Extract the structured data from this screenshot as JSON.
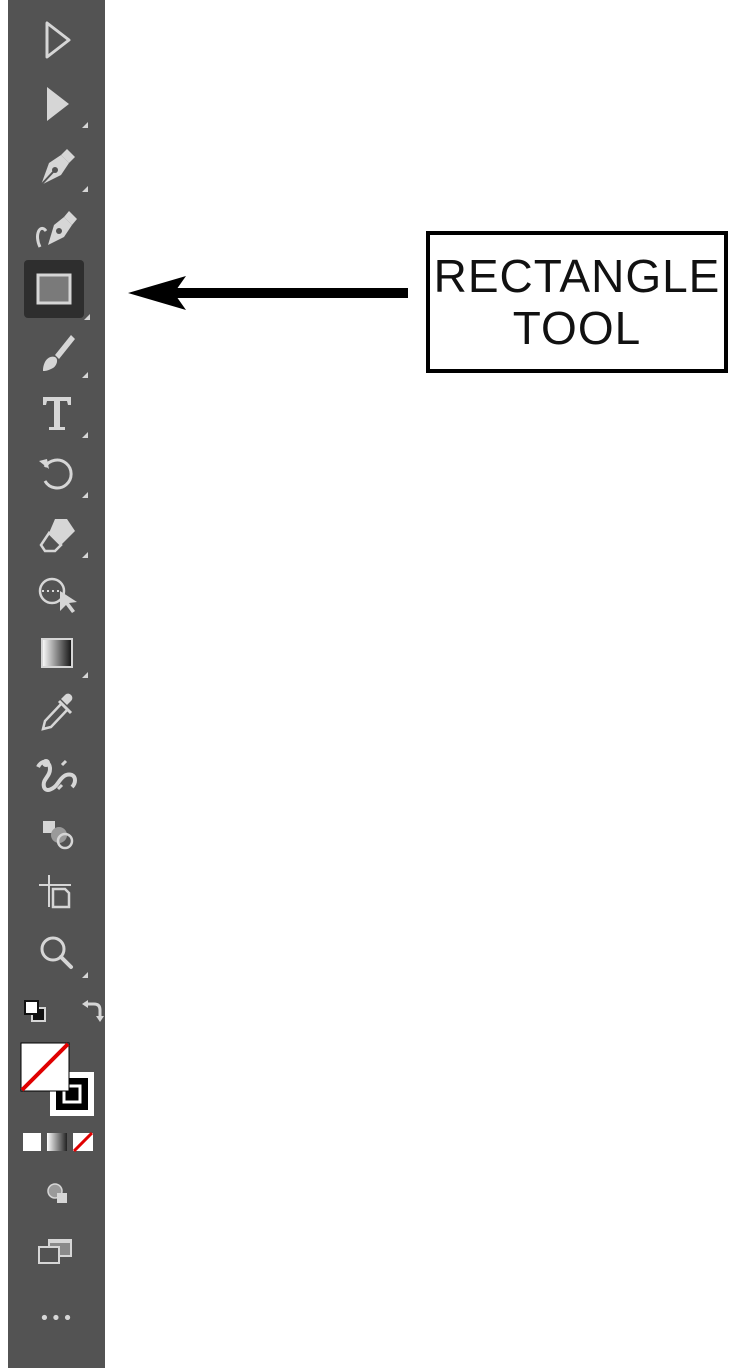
{
  "toolbar": {
    "tools": [
      {
        "name": "selection-tool",
        "icon": "hollow-arrow-icon"
      },
      {
        "name": "direct-selection-tool",
        "icon": "filled-arrow-icon"
      },
      {
        "name": "pen-tool",
        "icon": "pen-nib-icon"
      },
      {
        "name": "curvature-tool",
        "icon": "curvature-pen-icon"
      },
      {
        "name": "rectangle-tool",
        "icon": "rectangle-icon",
        "active": true
      },
      {
        "name": "paintbrush-tool",
        "icon": "paintbrush-icon"
      },
      {
        "name": "type-tool",
        "icon": "type-T-icon"
      },
      {
        "name": "rotate-tool",
        "icon": "rotate-icon"
      },
      {
        "name": "eraser-tool",
        "icon": "eraser-icon"
      },
      {
        "name": "shaper-tool",
        "icon": "puppet-warp-icon"
      },
      {
        "name": "gradient-tool",
        "icon": "gradient-icon"
      },
      {
        "name": "eyedropper-tool",
        "icon": "eyedropper-icon"
      },
      {
        "name": "blend-tool",
        "icon": "blend-icon"
      },
      {
        "name": "shape-builder-tool",
        "icon": "shape-builder-icon"
      },
      {
        "name": "artboard-tool",
        "icon": "artboard-icon"
      },
      {
        "name": "zoom-tool",
        "icon": "magnifier-icon"
      }
    ],
    "more_label": "•••"
  },
  "callout": {
    "line1": "RECTANGLE",
    "line2": "TOOL"
  },
  "colors": {
    "toolbar_bg": "#535353",
    "icon": "#d6d6d6",
    "active_bg": "#2e2e2e",
    "none_slash": "#e00000"
  }
}
